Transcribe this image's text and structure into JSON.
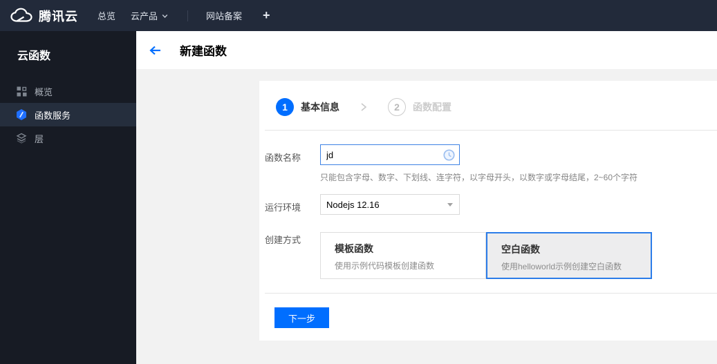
{
  "topbar": {
    "brand": "腾讯云",
    "items": [
      {
        "label": "总览"
      },
      {
        "label": "云产品",
        "icon": "chevron-down-icon"
      },
      {
        "label": "网站备案"
      },
      {
        "label": "+"
      }
    ]
  },
  "sidebar": {
    "title": "云函数",
    "items": [
      {
        "label": "概览",
        "icon": "grid-overview-icon",
        "selected": false
      },
      {
        "label": "函数服务",
        "icon": "function-hexagon-icon",
        "selected": true
      },
      {
        "label": "层",
        "icon": "layers-icon",
        "selected": false
      }
    ]
  },
  "header": {
    "back_icon": "back-arrow-icon",
    "title": "新建函数"
  },
  "wizard": {
    "steps": [
      {
        "number": "1",
        "label": "基本信息",
        "state": "active"
      },
      {
        "number": "2",
        "label": "函数配置",
        "state": "pending"
      }
    ]
  },
  "form": {
    "function_name": {
      "label": "函数名称",
      "value": "jd",
      "status_icon": "clock-pending-icon",
      "hint": "只能包含字母、数字、下划线、连字符，以字母开头，以数字或字母结尾，2~60个字符"
    },
    "runtime": {
      "label": "运行环境",
      "selected_option": "Nodejs 12.16",
      "caret_icon": "dropdown-caret-icon"
    },
    "creation_method": {
      "label": "创建方式",
      "options": [
        {
          "title": "模板函数",
          "description": "使用示例代码模板创建函数",
          "selected": false
        },
        {
          "title": "空白函数",
          "description": "使用helloworld示例创建空白函数",
          "selected": true
        }
      ]
    }
  },
  "footer": {
    "next_button": "下一步"
  },
  "colors": {
    "accent_blue": "#006eff",
    "selected_border_blue": "#2b7ce9",
    "topbar_bg": "#222a3a",
    "sidebar_bg": "#171b24",
    "sidebar_selected_bg": "#252e3d",
    "content_bg": "#f2f2f2"
  }
}
